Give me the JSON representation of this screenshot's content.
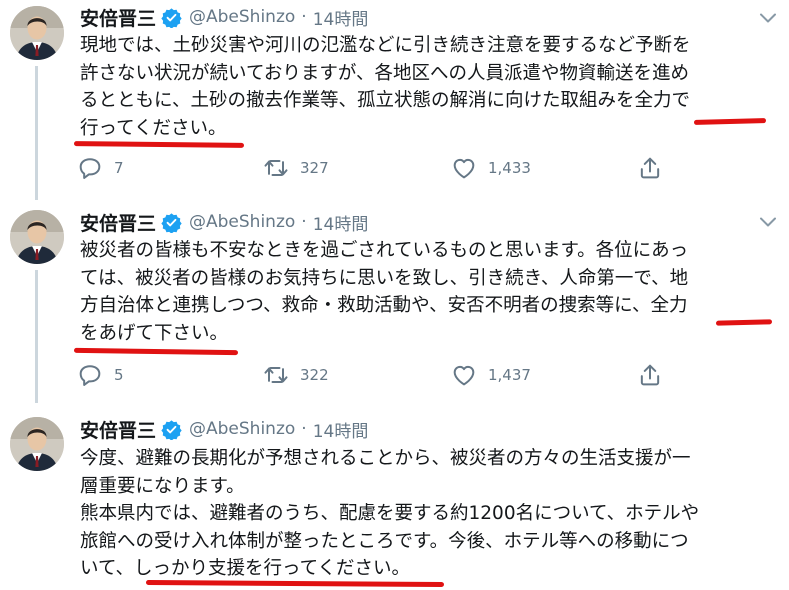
{
  "colors": {
    "accent": "#1da1f2",
    "muted": "#657786",
    "text": "#14171a",
    "underline": "#e01212"
  },
  "tweets": [
    {
      "name": "安倍晋三",
      "handle": "@AbeShinzo",
      "separator": "·",
      "time": "14時間",
      "lines": [
        "現地では、土砂災害や河川の氾濫などに引き続き注意を要するなど予断を",
        "許さない状況が続いておりますが、各地区への人員派遣や物資輸送を進め",
        "るとともに、土砂の撤去作業等、孤立状態の解消に向けた取組みを全力で",
        "行ってください。"
      ],
      "replies": "7",
      "retweets": "327",
      "likes": "1,433"
    },
    {
      "name": "安倍晋三",
      "handle": "@AbeShinzo",
      "separator": "·",
      "time": "14時間",
      "lines": [
        "被災者の皆様も不安なときを過ごされているものと思います。各位にあっ",
        "ては、被災者の皆様のお気持ちに思いを致し、引き続き、人命第一で、地",
        "方自治体と連携しつつ、救命・救助活動や、安否不明者の捜索等に、全力",
        "をあげて下さい。"
      ],
      "replies": "5",
      "retweets": "322",
      "likes": "1,437"
    },
    {
      "name": "安倍晋三",
      "handle": "@AbeShinzo",
      "separator": "·",
      "time": "14時間",
      "lines": [
        "今度、避難の長期化が予想されることから、被災者の方々の生活支援が一",
        "層重要になります。",
        "熊本県内では、避難者のうち、配慮を要する約1200名について、ホテルや",
        "旅館への受け入れ体制が整ったところです。今後、ホテル等への移動につ",
        "いて、しっかり支援を行ってください。"
      ]
    }
  ]
}
